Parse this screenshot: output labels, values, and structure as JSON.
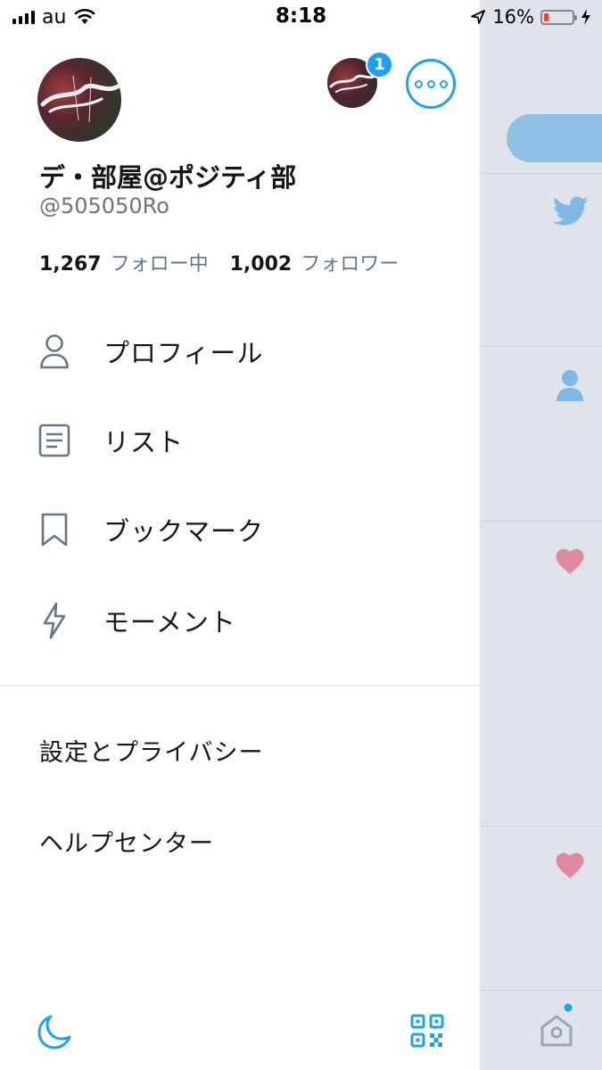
{
  "status_bar": {
    "carrier": "au",
    "time": "8:18",
    "battery_percent": "16%",
    "battery_level": 0.16
  },
  "profile": {
    "display_name": "デ・部屋@ポジティ部",
    "handle": "@505050Ro",
    "following_count": "1,267",
    "following_label": "フォロー中",
    "followers_count": "1,002",
    "followers_label": "フォロワー",
    "account_badge_count": "1"
  },
  "menu": {
    "items": [
      {
        "label": "プロフィール",
        "icon": "person-icon"
      },
      {
        "label": "リスト",
        "icon": "list-icon"
      },
      {
        "label": "ブックマーク",
        "icon": "bookmark-icon"
      },
      {
        "label": "モーメント",
        "icon": "lightning-icon"
      }
    ],
    "settings_label": "設定とプライバシー",
    "help_label": "ヘルプセンター"
  },
  "footer": {
    "night_mode_icon": "moon-icon",
    "qr_icon": "qr-code-icon"
  },
  "colors": {
    "accent": "#1da1f2",
    "text_primary": "#14171a",
    "text_secondary": "#657786",
    "icon_gray": "#657786",
    "heart": "#e0245e"
  }
}
